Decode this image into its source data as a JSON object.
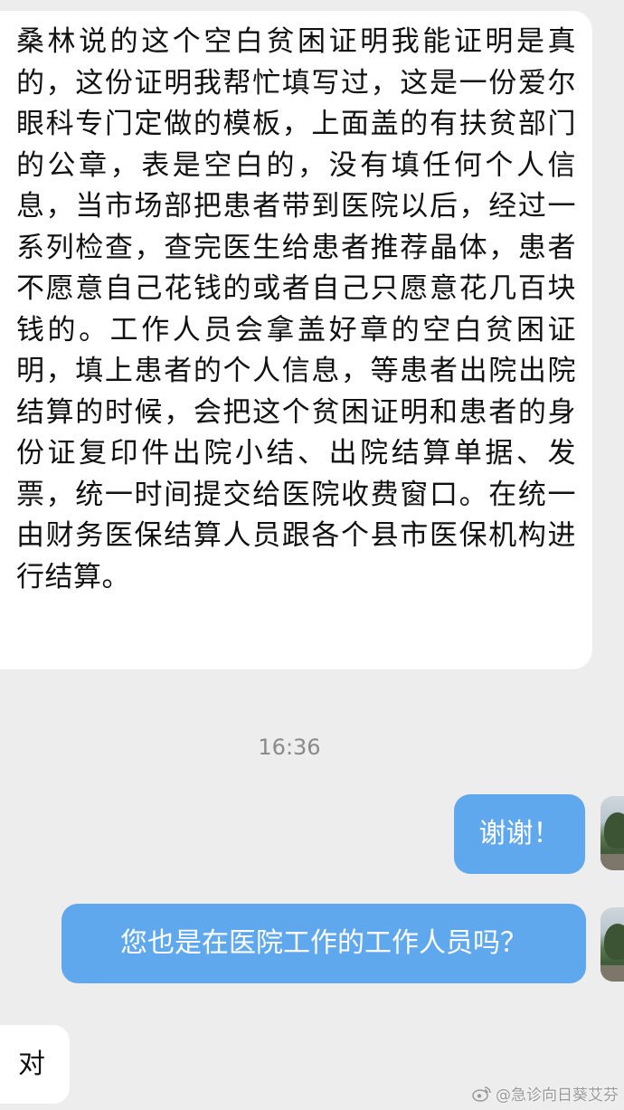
{
  "messages": {
    "long_incoming": "桑林说的这个空白贫困证明我能证明是真的，这份证明我帮忙填写过，这是一份爱尔眼科专门定做的模板，上面盖的有扶贫部门的公章，表是空白的，没有填任何个人信息，当市场部把患者带到医院以后，经过一系列检查，查完医生给患者推荐晶体，患者不愿意自己花钱的或者自己只愿意花几百块钱的。工作人员会拿盖好章的空白贫困证明，填上患者的个人信息，等患者出院出院结算的时候，会把这个贫困证明和患者的身份证复印件出院小结、出院结算单据、发票，统一时间提交给医院收费窗口。在统一由财务医保结算人员跟各个县市医保机构进行结算。",
    "timestamp": "16:36",
    "outgoing_1": "谢谢！",
    "outgoing_2": "您也是在医院工作的工作人员吗？",
    "incoming_2": "对"
  },
  "watermark": {
    "text": "@急诊向日葵艾芬",
    "icon": "weibo-icon"
  },
  "colors": {
    "background": "#ededed",
    "incoming_bubble": "#ffffff",
    "outgoing_bubble": "#5fa8ee"
  }
}
